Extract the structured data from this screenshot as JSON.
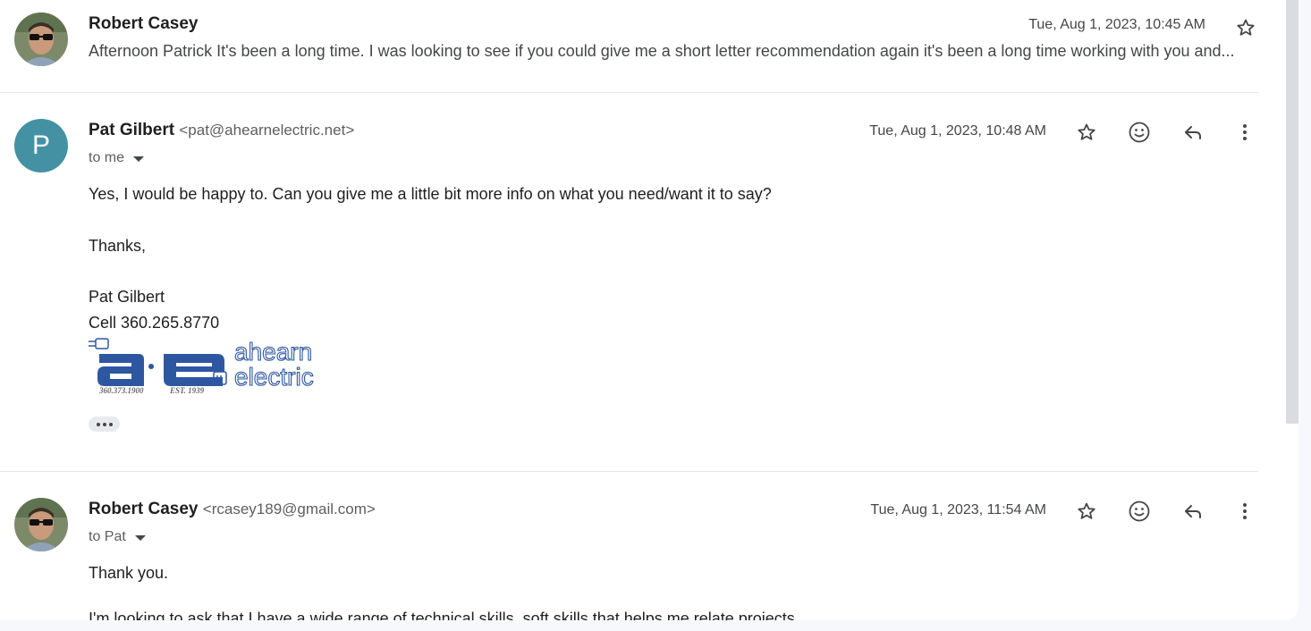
{
  "messages": [
    {
      "sender": "Robert Casey",
      "date": "Tue, Aug 1, 2023, 10:45 AM",
      "snippet": "Afternoon Patrick It's been a long time. I was looking to see if you could give me a short letter recommendation again it's been a long time working with you and..."
    },
    {
      "sender": "Pat Gilbert",
      "email": "<pat@ahearnelectric.net>",
      "avatar_letter": "P",
      "recipient": "to me",
      "date": "Tue, Aug 1, 2023, 10:48 AM",
      "body": {
        "line1": "Yes, I would be happy to. Can you give me a little bit more info on what you need/want it to say?",
        "line2": "Thanks,",
        "signature_name": "Pat Gilbert",
        "signature_cell": "Cell 360.265.8770"
      },
      "logo": {
        "letters": "ae",
        "name_top": "ahearn",
        "name_bottom": "electric",
        "phone": "360.373.1900",
        "est": "EST. 1939"
      }
    },
    {
      "sender": "Robert Casey",
      "email": "<rcasey189@gmail.com>",
      "recipient": "to Pat",
      "date": "Tue, Aug 1, 2023, 11:54 AM",
      "body": {
        "line1": "Thank you.",
        "line2_partial": "I'm looking to ask that I have a wide range of technical skills, soft skills that helps me relate projects"
      }
    }
  ],
  "icons": [
    "star-icon",
    "emoji-icon",
    "reply-icon",
    "more-vert-icon",
    "chevron-down-icon"
  ],
  "colors": {
    "avatar_p": "#4591a4",
    "logo_blue": "#2e57a2"
  }
}
